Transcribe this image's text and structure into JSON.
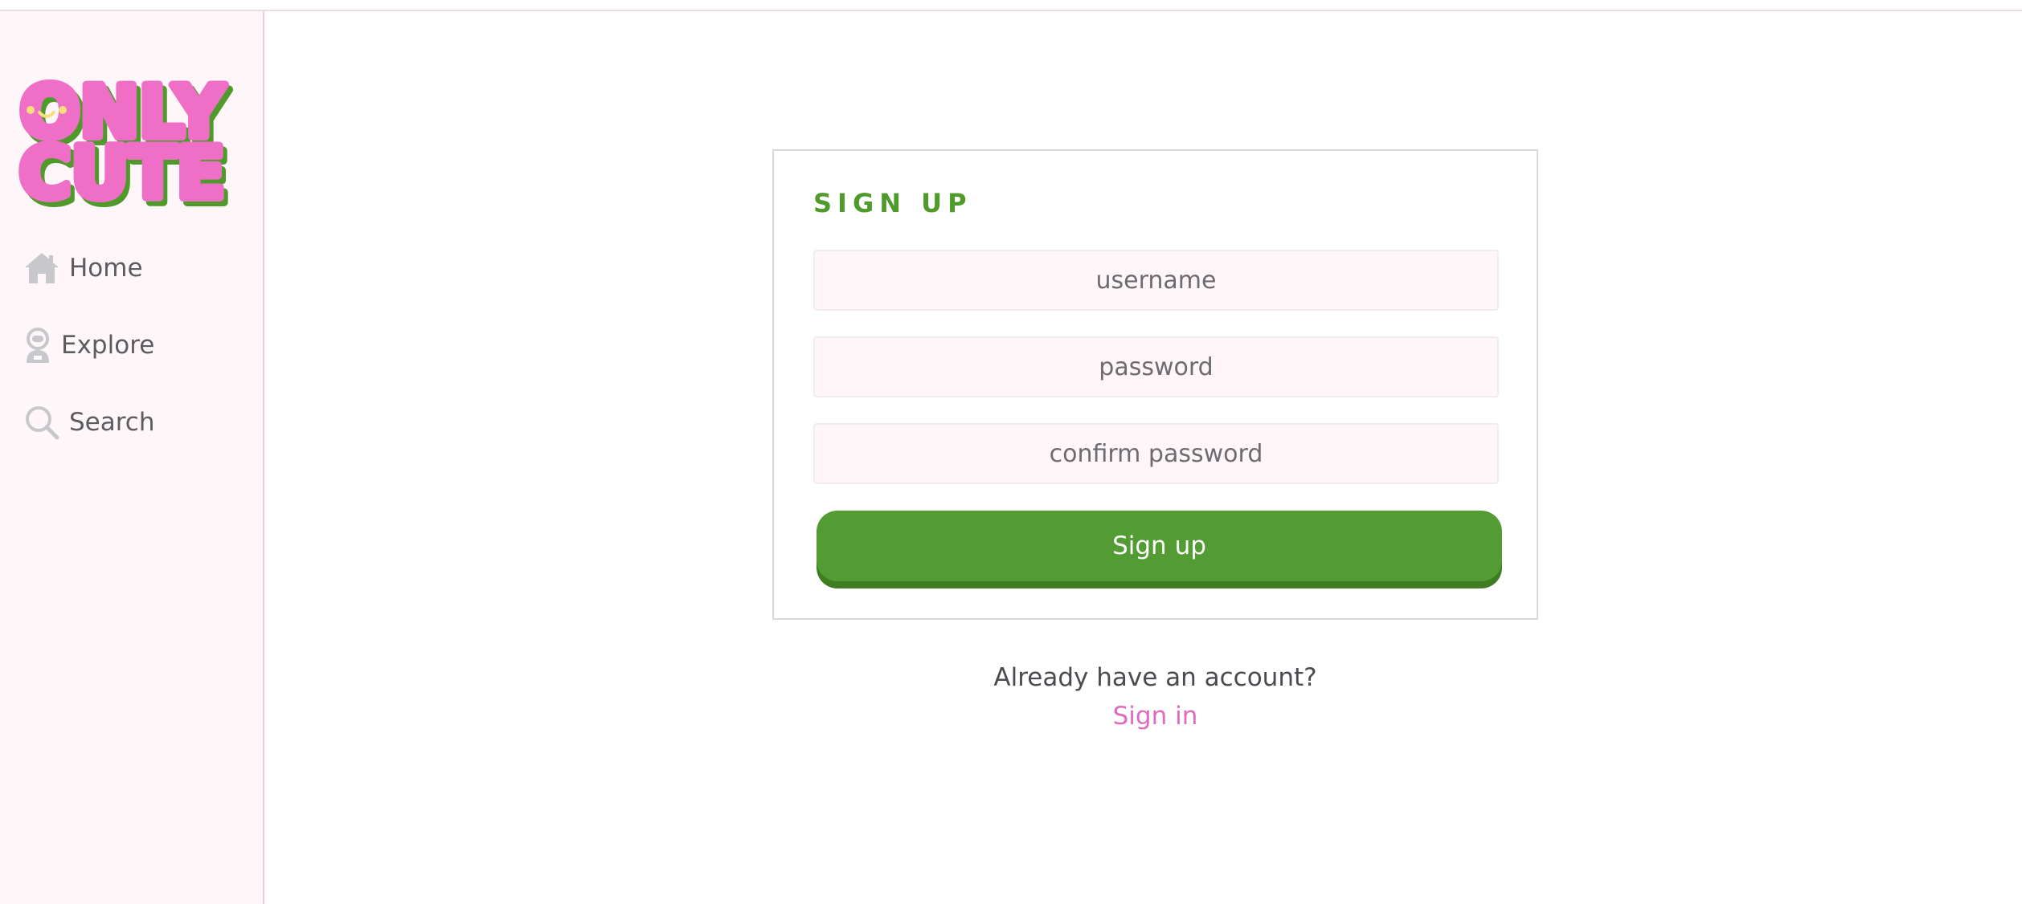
{
  "logo": {
    "line1": "ONLY",
    "line2": "CUTE"
  },
  "sidebar": {
    "items": [
      {
        "label": "Home",
        "icon": "home-icon"
      },
      {
        "label": "Explore",
        "icon": "astronaut-icon"
      },
      {
        "label": "Search",
        "icon": "search-icon"
      }
    ]
  },
  "form": {
    "title": "SIGN UP",
    "username_placeholder": "username",
    "password_placeholder": "password",
    "confirm_placeholder": "confirm password",
    "submit_label": "Sign up"
  },
  "footer": {
    "prompt": "Already have an account?",
    "link_label": "Sign in"
  },
  "colors": {
    "brand_pink": "#ef6fc6",
    "brand_green": "#539c33",
    "link_pink": "#e06bbe",
    "sidebar_bg": "#fff6fa"
  }
}
